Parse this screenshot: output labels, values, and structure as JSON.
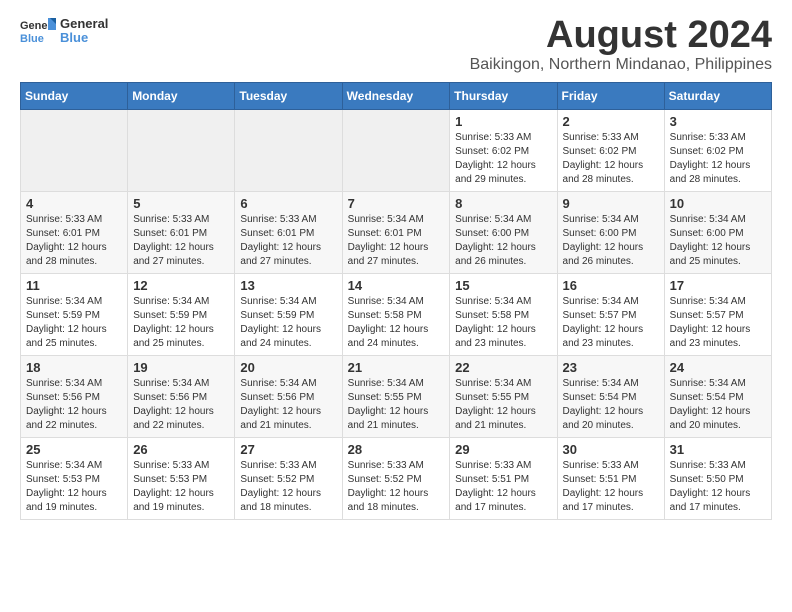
{
  "logo": {
    "line1": "General",
    "line2": "Blue"
  },
  "title": "August 2024",
  "subtitle": "Baikingon, Northern Mindanao, Philippines",
  "days_of_week": [
    "Sunday",
    "Monday",
    "Tuesday",
    "Wednesday",
    "Thursday",
    "Friday",
    "Saturday"
  ],
  "weeks": [
    [
      {
        "day": "",
        "info": ""
      },
      {
        "day": "",
        "info": ""
      },
      {
        "day": "",
        "info": ""
      },
      {
        "day": "",
        "info": ""
      },
      {
        "day": "1",
        "info": "Sunrise: 5:33 AM\nSunset: 6:02 PM\nDaylight: 12 hours\nand 29 minutes."
      },
      {
        "day": "2",
        "info": "Sunrise: 5:33 AM\nSunset: 6:02 PM\nDaylight: 12 hours\nand 28 minutes."
      },
      {
        "day": "3",
        "info": "Sunrise: 5:33 AM\nSunset: 6:02 PM\nDaylight: 12 hours\nand 28 minutes."
      }
    ],
    [
      {
        "day": "4",
        "info": "Sunrise: 5:33 AM\nSunset: 6:01 PM\nDaylight: 12 hours\nand 28 minutes."
      },
      {
        "day": "5",
        "info": "Sunrise: 5:33 AM\nSunset: 6:01 PM\nDaylight: 12 hours\nand 27 minutes."
      },
      {
        "day": "6",
        "info": "Sunrise: 5:33 AM\nSunset: 6:01 PM\nDaylight: 12 hours\nand 27 minutes."
      },
      {
        "day": "7",
        "info": "Sunrise: 5:34 AM\nSunset: 6:01 PM\nDaylight: 12 hours\nand 27 minutes."
      },
      {
        "day": "8",
        "info": "Sunrise: 5:34 AM\nSunset: 6:00 PM\nDaylight: 12 hours\nand 26 minutes."
      },
      {
        "day": "9",
        "info": "Sunrise: 5:34 AM\nSunset: 6:00 PM\nDaylight: 12 hours\nand 26 minutes."
      },
      {
        "day": "10",
        "info": "Sunrise: 5:34 AM\nSunset: 6:00 PM\nDaylight: 12 hours\nand 25 minutes."
      }
    ],
    [
      {
        "day": "11",
        "info": "Sunrise: 5:34 AM\nSunset: 5:59 PM\nDaylight: 12 hours\nand 25 minutes."
      },
      {
        "day": "12",
        "info": "Sunrise: 5:34 AM\nSunset: 5:59 PM\nDaylight: 12 hours\nand 25 minutes."
      },
      {
        "day": "13",
        "info": "Sunrise: 5:34 AM\nSunset: 5:59 PM\nDaylight: 12 hours\nand 24 minutes."
      },
      {
        "day": "14",
        "info": "Sunrise: 5:34 AM\nSunset: 5:58 PM\nDaylight: 12 hours\nand 24 minutes."
      },
      {
        "day": "15",
        "info": "Sunrise: 5:34 AM\nSunset: 5:58 PM\nDaylight: 12 hours\nand 23 minutes."
      },
      {
        "day": "16",
        "info": "Sunrise: 5:34 AM\nSunset: 5:57 PM\nDaylight: 12 hours\nand 23 minutes."
      },
      {
        "day": "17",
        "info": "Sunrise: 5:34 AM\nSunset: 5:57 PM\nDaylight: 12 hours\nand 23 minutes."
      }
    ],
    [
      {
        "day": "18",
        "info": "Sunrise: 5:34 AM\nSunset: 5:56 PM\nDaylight: 12 hours\nand 22 minutes."
      },
      {
        "day": "19",
        "info": "Sunrise: 5:34 AM\nSunset: 5:56 PM\nDaylight: 12 hours\nand 22 minutes."
      },
      {
        "day": "20",
        "info": "Sunrise: 5:34 AM\nSunset: 5:56 PM\nDaylight: 12 hours\nand 21 minutes."
      },
      {
        "day": "21",
        "info": "Sunrise: 5:34 AM\nSunset: 5:55 PM\nDaylight: 12 hours\nand 21 minutes."
      },
      {
        "day": "22",
        "info": "Sunrise: 5:34 AM\nSunset: 5:55 PM\nDaylight: 12 hours\nand 21 minutes."
      },
      {
        "day": "23",
        "info": "Sunrise: 5:34 AM\nSunset: 5:54 PM\nDaylight: 12 hours\nand 20 minutes."
      },
      {
        "day": "24",
        "info": "Sunrise: 5:34 AM\nSunset: 5:54 PM\nDaylight: 12 hours\nand 20 minutes."
      }
    ],
    [
      {
        "day": "25",
        "info": "Sunrise: 5:34 AM\nSunset: 5:53 PM\nDaylight: 12 hours\nand 19 minutes."
      },
      {
        "day": "26",
        "info": "Sunrise: 5:33 AM\nSunset: 5:53 PM\nDaylight: 12 hours\nand 19 minutes."
      },
      {
        "day": "27",
        "info": "Sunrise: 5:33 AM\nSunset: 5:52 PM\nDaylight: 12 hours\nand 18 minutes."
      },
      {
        "day": "28",
        "info": "Sunrise: 5:33 AM\nSunset: 5:52 PM\nDaylight: 12 hours\nand 18 minutes."
      },
      {
        "day": "29",
        "info": "Sunrise: 5:33 AM\nSunset: 5:51 PM\nDaylight: 12 hours\nand 17 minutes."
      },
      {
        "day": "30",
        "info": "Sunrise: 5:33 AM\nSunset: 5:51 PM\nDaylight: 12 hours\nand 17 minutes."
      },
      {
        "day": "31",
        "info": "Sunrise: 5:33 AM\nSunset: 5:50 PM\nDaylight: 12 hours\nand 17 minutes."
      }
    ]
  ]
}
